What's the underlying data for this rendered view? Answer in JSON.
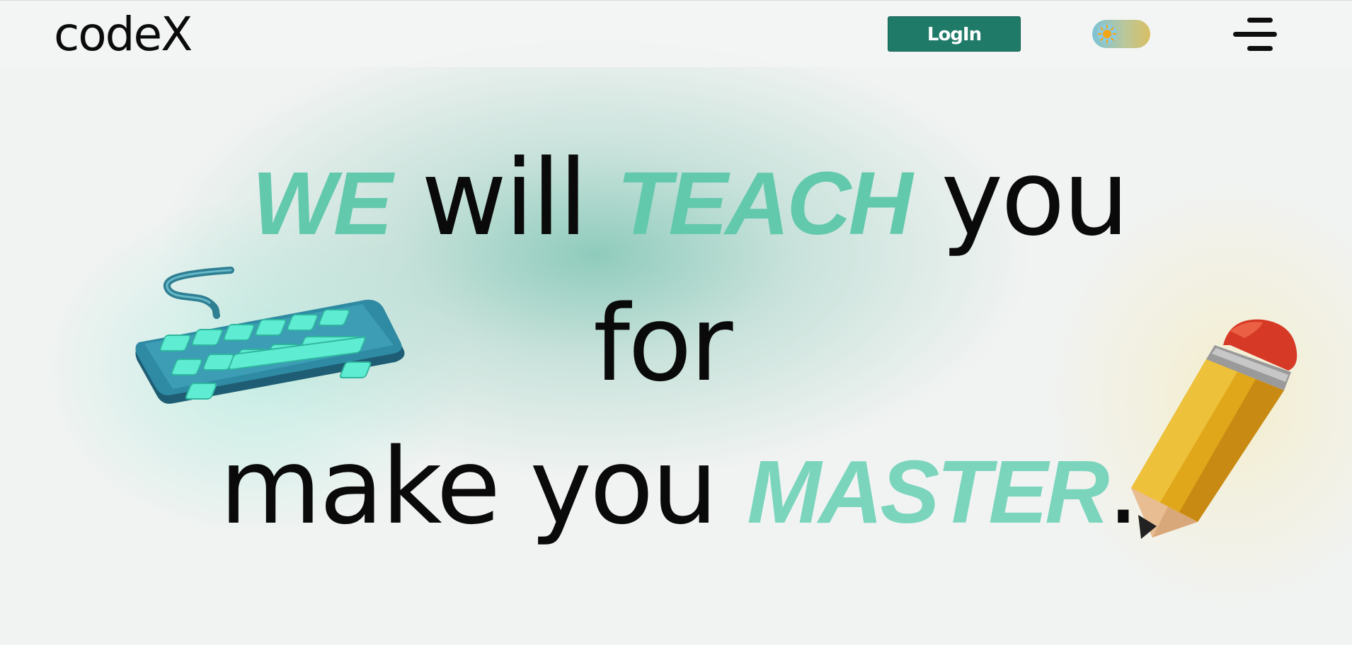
{
  "header": {
    "logo": "codeX",
    "login_label": "LogIn",
    "theme_toggle_icon": "sun-icon",
    "menu_icon": "hamburger-menu-icon"
  },
  "hero": {
    "line1": {
      "accent1": "WE",
      "word1": "will",
      "accent2": "TEACH",
      "word2": "you"
    },
    "line2": {
      "word1": "for"
    },
    "line3": {
      "word1": "make you",
      "accent1": "MASTER",
      "punctuation": "."
    }
  },
  "illustrations": {
    "left": "keyboard-illustration",
    "right": "pencil-illustration"
  },
  "colors": {
    "brand": "#1f7a68",
    "accent": "#5cc7a8",
    "accent_light": "#7bd5bd",
    "text": "#0a0a0a",
    "background": "#f1f3f2"
  }
}
